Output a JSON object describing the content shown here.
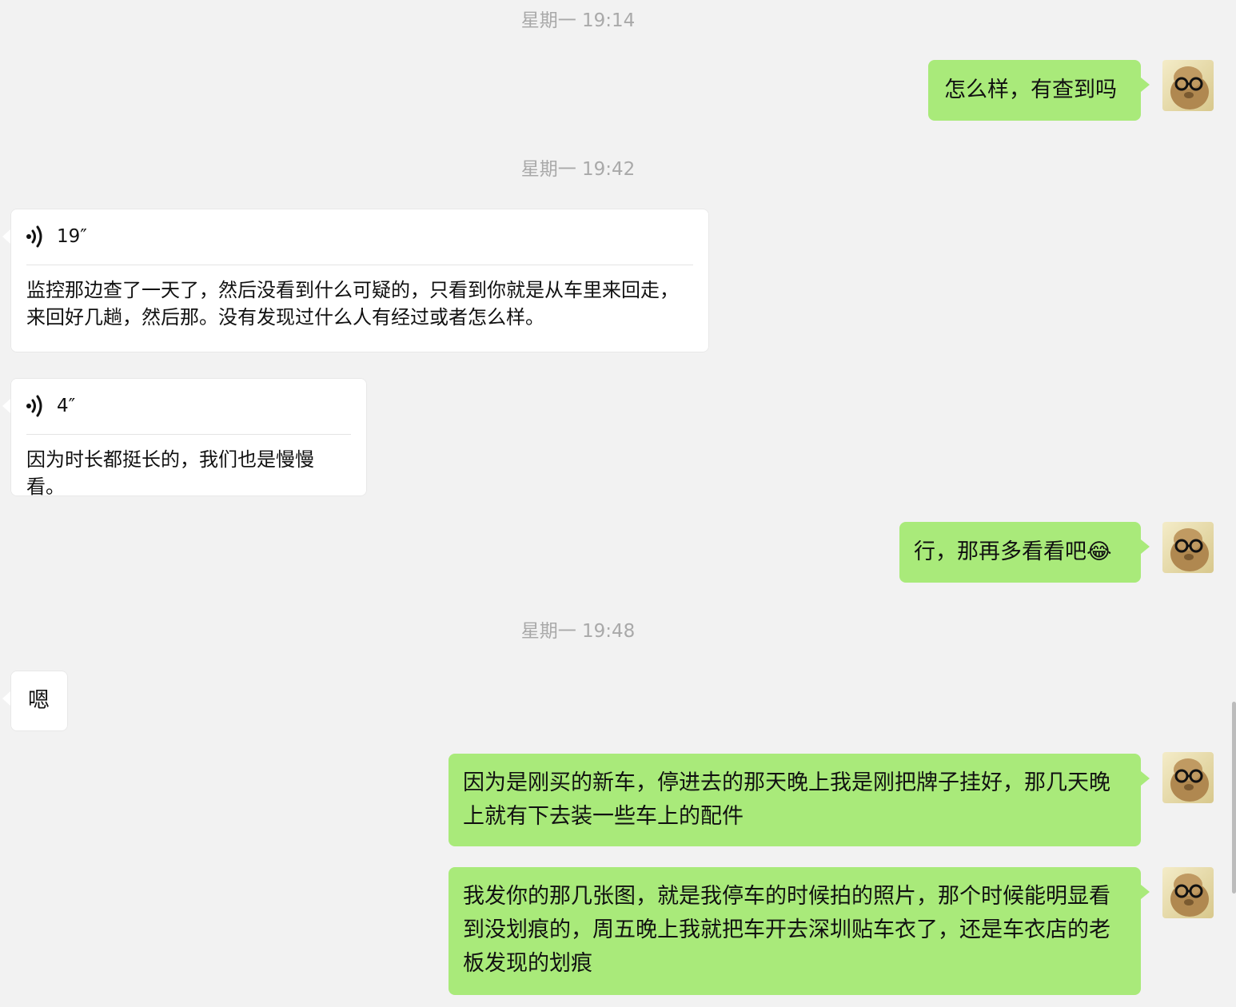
{
  "timestamps": [
    "星期一 19:14",
    "星期一 19:42",
    "星期一 19:48"
  ],
  "messages": {
    "m1": "怎么样，有查到吗",
    "v1_duration": "19″",
    "v1_transcript": "监控那边查了一天了，然后没看到什么可疑的，只看到你就是从车里来回走，来回好几趟，然后那。没有发现过什么人有经过或者怎么样。",
    "v2_duration": "4″",
    "v2_transcript": "因为时长都挺长的，我们也是慢慢看。",
    "m2": "行，那再多看看吧😂",
    "m3": "嗯",
    "m4": "因为是刚买的新车，停进去的那天晚上我是刚把牌子挂好，那几天晚上就有下去装一些车上的配件",
    "m5": "我发你的那几张图，就是我停车的时候拍的照片，那个时候能明显看到没划痕的，周五晚上我就把车开去深圳贴车衣了，还是车衣店的老板发现的划痕"
  },
  "colors": {
    "self_bubble": "#a9ea7a",
    "other_bubble": "#ffffff",
    "background": "#f2f2f2"
  },
  "icons": {
    "voice": "voice-wave-icon",
    "avatar": "avatar-dog-glasses"
  }
}
